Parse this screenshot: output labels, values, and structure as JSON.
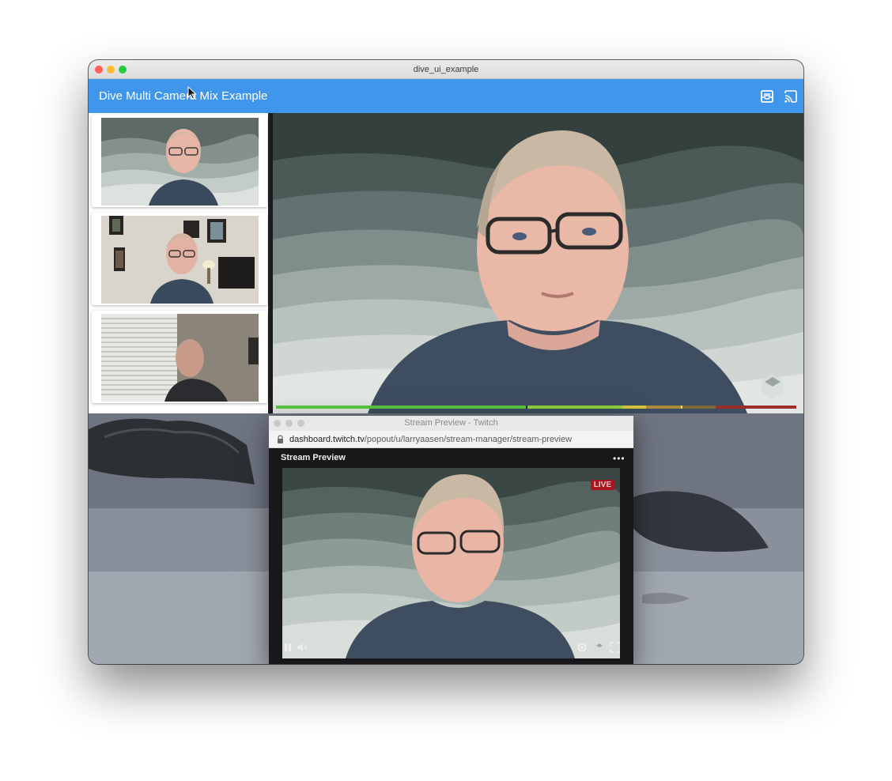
{
  "window": {
    "title": "dive_ui_example"
  },
  "appbar": {
    "title": "Dive Multi Camera Mix Example",
    "icons": [
      "inbox-icon",
      "cast-icon"
    ]
  },
  "cameras": [
    {
      "name": "camera-1",
      "scene": "wave-background"
    },
    {
      "name": "camera-2",
      "scene": "office-frames"
    },
    {
      "name": "camera-3",
      "scene": "window-blinds"
    }
  ],
  "main_preview": {
    "scene": "wave-background"
  },
  "audio_meter": {
    "colors": [
      "#57c940",
      "#8fd13a",
      "#d8c43a",
      "#a98b3a",
      "#9b2d2a"
    ]
  },
  "twitch_window": {
    "title": "Stream Preview - Twitch",
    "url_domain": "dashboard.twitch.tv",
    "url_path": "/popout/u/larryaasen/stream-manager/stream-preview",
    "header_title": "Stream Preview",
    "more": "•••",
    "live_badge": "LIVE"
  },
  "colors": {
    "appbar": "#4096ea",
    "twitch_bg": "#18181b",
    "live": "#a6161c"
  }
}
